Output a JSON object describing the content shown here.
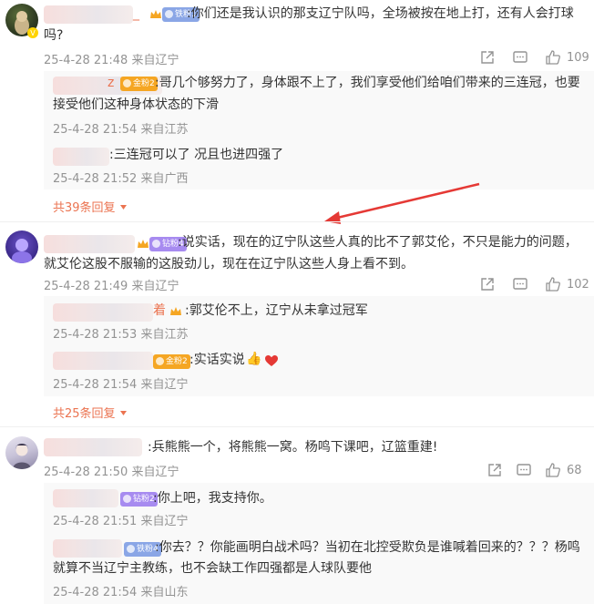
{
  "comments": [
    {
      "text": ":你们还是我认识的那支辽宁队吗，全场被按在地上打，还有人会打球吗?",
      "line1": ":你们还是我认识的那支辽宁队吗，全场被按在地上打，还有人会打球",
      "line2": "吗?",
      "name_tail": "_",
      "badge": "铁粉1",
      "meta": "25-4-28 21:48 来自辽宁",
      "likes": "109",
      "replies": [
        {
          "line1": ":哥几个够努力了，身体跟不上了，我们享受他们给咱们带来的三连冠，也要",
          "line2": "接受他们这种身体状态的下滑",
          "badge": "金粉2",
          "name_tail": "z",
          "meta": "25-4-28 21:54 来自江苏"
        },
        {
          "line1": ":三连冠可以了 况且也进四强了",
          "meta": "25-4-28 21:52 来自广西"
        }
      ],
      "more": "共39条回复"
    },
    {
      "line1": ":说实话，现在的辽宁队这些人真的比不了郭艾伦，不只是能力的问题，",
      "line2": "就艾伦这股不服输的这股劲儿，现在在辽宁队这些人身上看不到。",
      "badge": "钻粉4",
      "meta": "25-4-28 21:49 来自辽宁",
      "likes": "102",
      "replies": [
        {
          "line1": ":郭艾伦不上，辽宁从未拿过冠军",
          "name_tail": "着",
          "meta": "25-4-28 21:53 来自江苏"
        },
        {
          "line1": ":实话实说",
          "badge": "金粉2",
          "meta": "25-4-28 21:54 来自辽宁"
        }
      ],
      "more": "共25条回复"
    },
    {
      "line1": ":兵熊熊一个，将熊熊一窝。杨鸣下课吧，辽篮重建!",
      "meta": "25-4-28 21:50 来自辽宁",
      "likes": "68",
      "replies": [
        {
          "line1": ":你上吧，我支持你。",
          "badge": "钻粉2",
          "meta": "25-4-28 21:51 来自辽宁"
        },
        {
          "line1": ":你去？？你能画明白战术吗？当初在北控受欺负是谁喊着回来的？？？杨鸣",
          "line2": "就算不当辽宁主教练，也不会缺工作四强都是人球队要他",
          "badge": "铁粉4",
          "meta": "25-4-28 21:54 来自山东"
        }
      ]
    }
  ],
  "colors": {
    "accent": "#eb7350",
    "meta": "#939393",
    "arrow": "#e53935",
    "heart": "#e53935",
    "thumb": "#f2b33d"
  },
  "icons": [
    "share-icon",
    "comment-icon",
    "like-icon",
    "crown-icon",
    "thumbs-up-emoji",
    "heart-emoji",
    "caret-down-icon"
  ]
}
